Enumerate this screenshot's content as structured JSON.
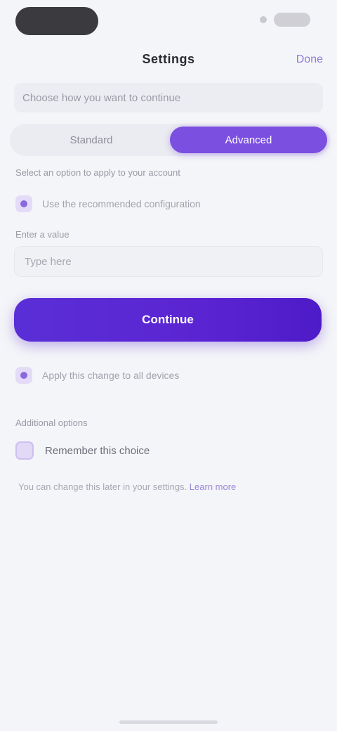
{
  "nav": {
    "title": "Settings",
    "action": "Done"
  },
  "context": {
    "text": "Choose how you want to continue"
  },
  "segment": {
    "options": [
      "Standard",
      "Advanced"
    ],
    "selected": "Advanced"
  },
  "section1": {
    "label": "Select an option to apply to your account",
    "option_text": "Use the recommended configuration"
  },
  "section2": {
    "label": "Enter a value",
    "field_placeholder": "Type here"
  },
  "primary_button": {
    "label": "Continue"
  },
  "option2": {
    "text": "Apply this change to all devices"
  },
  "section3": {
    "label": "Additional options",
    "toggle_text": "Remember this choice"
  },
  "footnote": {
    "text": "You can change this later in your settings.",
    "link": "Learn more"
  },
  "colors": {
    "accent": "#7b4fe0",
    "primary": "#5a2fd6",
    "background": "#f4f5f8"
  }
}
